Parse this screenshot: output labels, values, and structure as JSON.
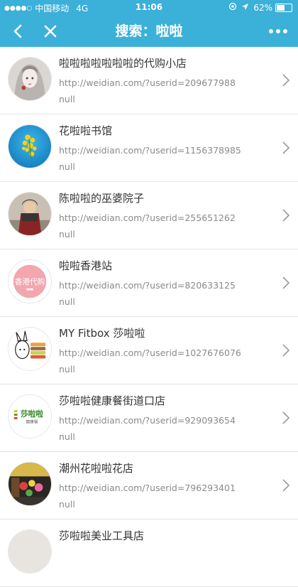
{
  "status_bar": {
    "signal_dots": "●●●●○",
    "carrier": "中国移动",
    "network": "4G",
    "time": "11:06",
    "battery": "62%",
    "battery_level": 0.62
  },
  "nav": {
    "title": "搜索：啦啦"
  },
  "results": [
    {
      "name": "啦啦啦啦啦啦啦的代购小店",
      "url": "http://weidian.com/?userid=209677988",
      "note": "null",
      "avatar": "illustrated-girl-avatar"
    },
    {
      "name": "花啦啦书馆",
      "url": "http://weidian.com/?userid=1156378985",
      "note": "null",
      "avatar": "yellow-flowers-avatar"
    },
    {
      "name": "陈啦啦的巫婆院子",
      "url": "http://weidian.com/?userid=255651262",
      "note": "null",
      "avatar": "person-photo-avatar"
    },
    {
      "name": "啦啦香港站",
      "url": "http://weidian.com/?userid=820633125",
      "note": "null",
      "avatar": "hongkong-daigou-avatar"
    },
    {
      "name": "MY Fitbox 莎啦啦",
      "url": "http://weidian.com/?userid=1027676076",
      "note": "null",
      "avatar": "rabbit-food-avatar"
    },
    {
      "name": "莎啦啦健康餐街道口店",
      "url": "http://weidian.com/?userid=929093654",
      "note": "null",
      "avatar": "shalala-logo-avatar"
    },
    {
      "name": "潮州花啦啦花店",
      "url": "http://weidian.com/?userid=796293401",
      "note": "null",
      "avatar": "flower-shop-avatar"
    },
    {
      "name": "莎啦啦美业工具店",
      "url": "",
      "note": "",
      "avatar": "partial-avatar"
    }
  ],
  "avatar_texts": {
    "hongkong": "香港代购",
    "shalala_logo": "莎啦啦",
    "shalala_sub": "健康餐"
  },
  "colors": {
    "brand": "#3bb0d8",
    "name_text": "#333333",
    "meta_text": "#8a8a8a"
  }
}
